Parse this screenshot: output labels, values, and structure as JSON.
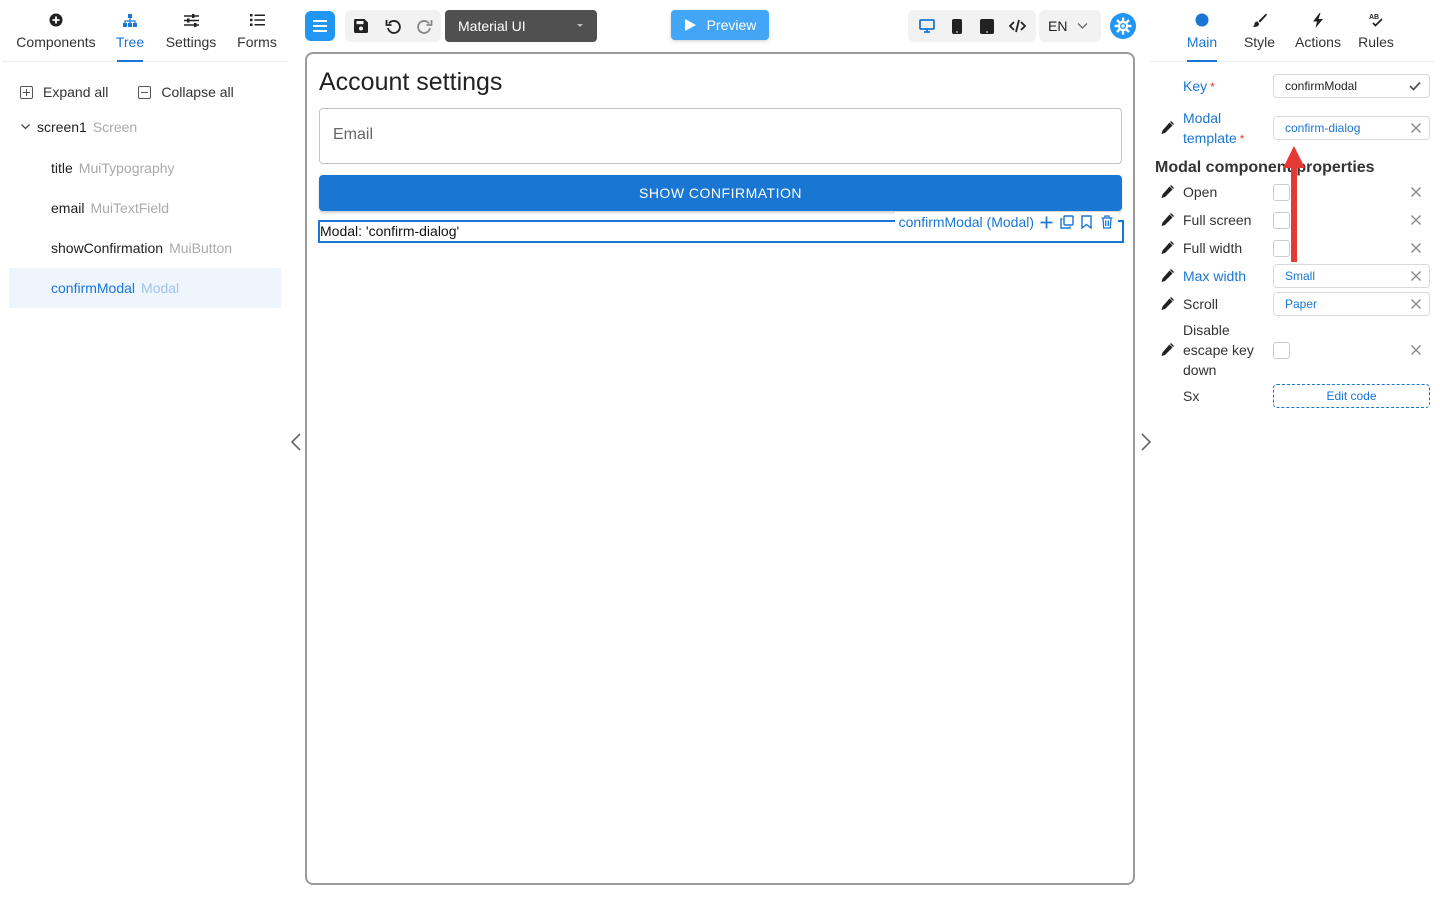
{
  "left_panel": {
    "tabs": [
      {
        "label": "Components",
        "icon": "plus-circle-icon"
      },
      {
        "label": "Tree",
        "icon": "sitemap-icon",
        "active": true
      },
      {
        "label": "Settings",
        "icon": "sliders-icon"
      },
      {
        "label": "Forms",
        "icon": "list-icon"
      }
    ],
    "expand_all": "Expand all",
    "collapse_all": "Collapse all",
    "tree": {
      "root": {
        "name": "screen1",
        "type": "Screen"
      },
      "children": [
        {
          "name": "title",
          "type": "MuiTypography"
        },
        {
          "name": "email",
          "type": "MuiTextField"
        },
        {
          "name": "showConfirmation",
          "type": "MuiButton"
        },
        {
          "name": "confirmModal",
          "type": "Modal",
          "selected": true
        }
      ]
    }
  },
  "toolbar": {
    "theme_select": "Material UI",
    "preview_label": "Preview",
    "language": "EN",
    "icons": [
      "menu-icon",
      "save-icon",
      "undo-icon",
      "redo-icon",
      "desktop-icon",
      "mobile-icon",
      "tablet-icon",
      "code-icon",
      "settings-gear-icon"
    ]
  },
  "canvas": {
    "title": "Account settings",
    "email_placeholder": "Email",
    "button_label": "SHOW CONFIRMATION",
    "modal_text": "Modal: 'confirm-dialog'",
    "component_label": "confirmModal (Modal)"
  },
  "right_panel": {
    "tabs": [
      {
        "label": "Main",
        "icon": "dot-icon",
        "active": true
      },
      {
        "label": "Style",
        "icon": "brush-icon"
      },
      {
        "label": "Actions",
        "icon": "bolt-icon"
      },
      {
        "label": "Rules",
        "icon": "spellcheck-icon"
      }
    ],
    "key_label": "Key",
    "key_value": "confirmModal",
    "template_label_1": "Modal",
    "template_label_2": "template",
    "template_value": "confirm-dialog",
    "section_title": "Modal component properties",
    "props": {
      "open": "Open",
      "full_screen": "Full screen",
      "full_width": "Full width",
      "max_width": "Max width",
      "max_width_value": "Small",
      "scroll": "Scroll",
      "scroll_value": "Paper",
      "disable_escape_1": "Disable",
      "disable_escape_2": "escape key",
      "disable_escape_3": "down",
      "sx": "Sx",
      "edit_code": "Edit code"
    }
  },
  "colors": {
    "accent": "#1976d2",
    "preview": "#42a5f5",
    "annotation": "#e53935",
    "selected_bg": "#eef5fd"
  }
}
